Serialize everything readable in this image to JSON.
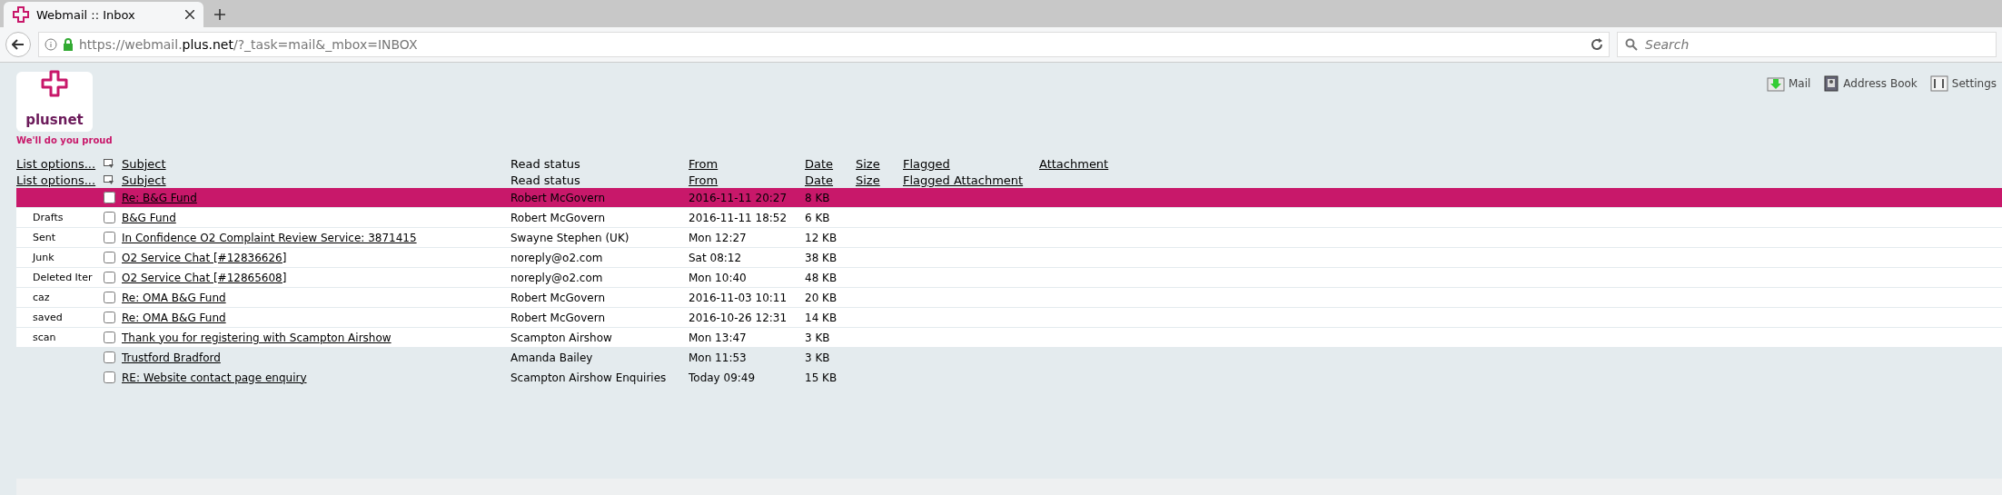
{
  "browser": {
    "tab": {
      "title": "Webmail :: Inbox",
      "selected": true
    },
    "url": {
      "prefix": "https://webmail.",
      "domain": "plus.net",
      "path": "/?_task=mail&_mbox=INBOX"
    },
    "search": {
      "placeholder": "Search"
    }
  },
  "logo": {
    "name": "plusnet",
    "tagline": "We'll do you proud"
  },
  "toolbar": [
    {
      "label": "Mail",
      "kind": "mail"
    },
    {
      "label": "Address Book",
      "kind": "book"
    },
    {
      "label": "Settings",
      "kind": "settings"
    }
  ],
  "list_header": {
    "options": "List options...",
    "columns": [
      "Subject",
      "Read status",
      "From",
      "Date",
      "Size",
      "Flagged",
      "Attachment"
    ]
  },
  "list_header_2": {
    "options": "List options...",
    "columns": [
      "Subject",
      "Read status",
      "From",
      "Date",
      "Size",
      "Flagged Attachment"
    ]
  },
  "folders": [
    "Drafts",
    "Sent",
    "Junk",
    "Deleted Iter",
    "caz",
    "saved",
    "scan"
  ],
  "messages": [
    {
      "subject": "Re: B&G Fund",
      "from": "Robert McGovern",
      "date": "2016-11-11 20:27",
      "size": "8 KB",
      "selected": true,
      "checked": false
    },
    {
      "subject": "B&G Fund",
      "from": "Robert McGovern",
      "date": "2016-11-11 18:52",
      "size": "6 KB",
      "selected": false,
      "checked": false
    },
    {
      "subject": "In Confidence O2 Complaint Review Service: 3871415",
      "from": "Swayne Stephen (UK)",
      "date": "Mon 12:27",
      "size": "12 KB",
      "selected": false,
      "checked": false
    },
    {
      "subject": "O2 Service Chat [#12836626]",
      "from": "noreply@o2.com",
      "date": "Sat 08:12",
      "size": "38 KB",
      "selected": false,
      "checked": false
    },
    {
      "subject": "O2 Service Chat [#12865608]",
      "from": "noreply@o2.com",
      "date": "Mon 10:40",
      "size": "48 KB",
      "selected": false,
      "checked": false
    },
    {
      "subject": "Re: OMA B&G Fund",
      "from": "Robert McGovern",
      "date": "2016-11-03 10:11",
      "size": "20 KB",
      "selected": false,
      "checked": false
    },
    {
      "subject": "Re: OMA B&G Fund",
      "from": "Robert McGovern",
      "date": "2016-10-26 12:31",
      "size": "14 KB",
      "selected": false,
      "checked": false
    },
    {
      "subject": "Thank you for registering with Scampton Airshow",
      "from": "Scampton Airshow",
      "date": "Mon 13:47",
      "size": "3 KB",
      "selected": false,
      "checked": false
    },
    {
      "subject": "Trustford Bradford",
      "from": "Amanda Bailey",
      "date": "Mon 11:53",
      "size": "3 KB",
      "selected": false,
      "checked": false
    },
    {
      "subject": "RE: Website contact page enquiry",
      "from": "Scampton Airshow Enquiries",
      "date": "Today 09:49",
      "size": "15 KB",
      "selected": false,
      "checked": false
    }
  ]
}
